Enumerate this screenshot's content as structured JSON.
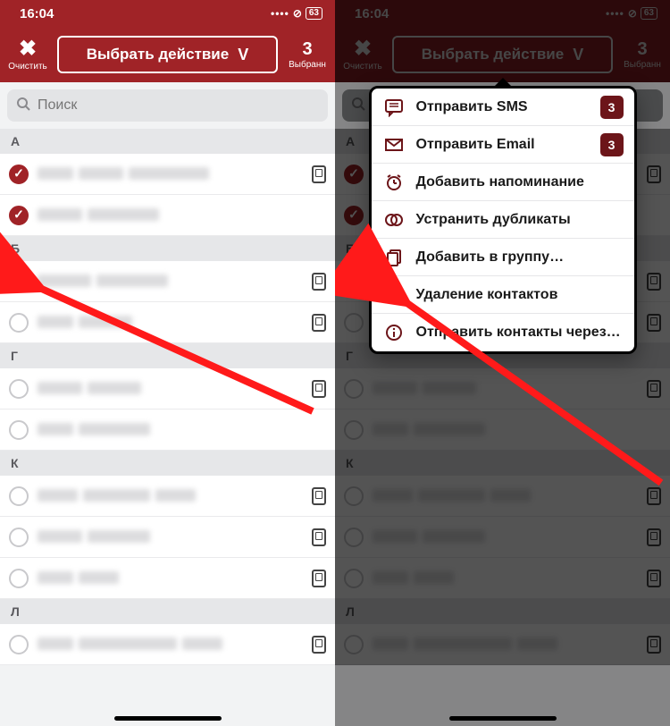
{
  "status": {
    "time": "16:04",
    "battery": "63"
  },
  "toolbar": {
    "clear_label": "Очистить",
    "action_label": "Выбрать действие",
    "selected_count": "3",
    "selected_label": "Выбранн"
  },
  "search": {
    "placeholder": "Поиск"
  },
  "sections": {
    "a": "А",
    "b": "Б",
    "g": "Г",
    "k": "К",
    "l": "Л"
  },
  "menu": {
    "sms": "Отправить SMS",
    "email": "Отправить Email",
    "reminder": "Добавить напоминание",
    "dedupe": "Устранить дубликаты",
    "group": "Добавить в группу…",
    "delete": "Удаление контактов",
    "share": "Отправить контакты через…",
    "badge": "3"
  }
}
